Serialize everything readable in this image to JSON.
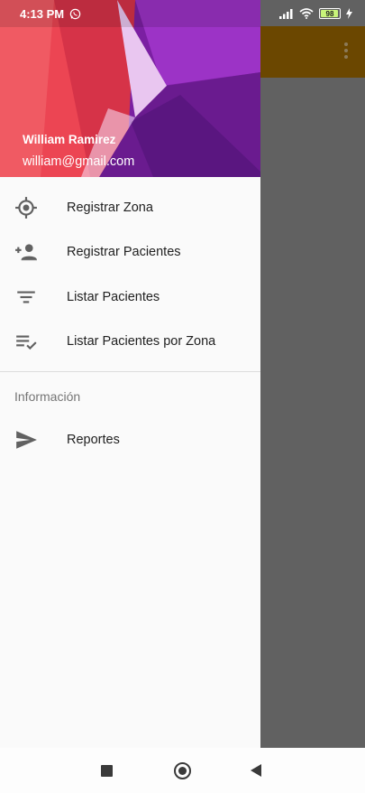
{
  "status_bar": {
    "time": "4:13 PM",
    "battery_level": "98"
  },
  "drawer": {
    "user_name": "William Ramirez",
    "user_email": "william@gmail.com",
    "items": [
      {
        "label": "Registrar Zona",
        "icon": "gps-target-icon"
      },
      {
        "label": "Registrar Pacientes",
        "icon": "person-add-icon"
      },
      {
        "label": "Listar Pacientes",
        "icon": "filter-list-icon"
      },
      {
        "label": "Listar Pacientes por Zona",
        "icon": "playlist-check-icon"
      }
    ],
    "section_title": "Información",
    "section_items": [
      {
        "label": "Reportes",
        "icon": "send-icon"
      }
    ]
  },
  "colors": {
    "toolbar": "#6b4700",
    "scrim": "#616161",
    "header_purple": "#7a1fa2",
    "header_red": "#e53945"
  }
}
